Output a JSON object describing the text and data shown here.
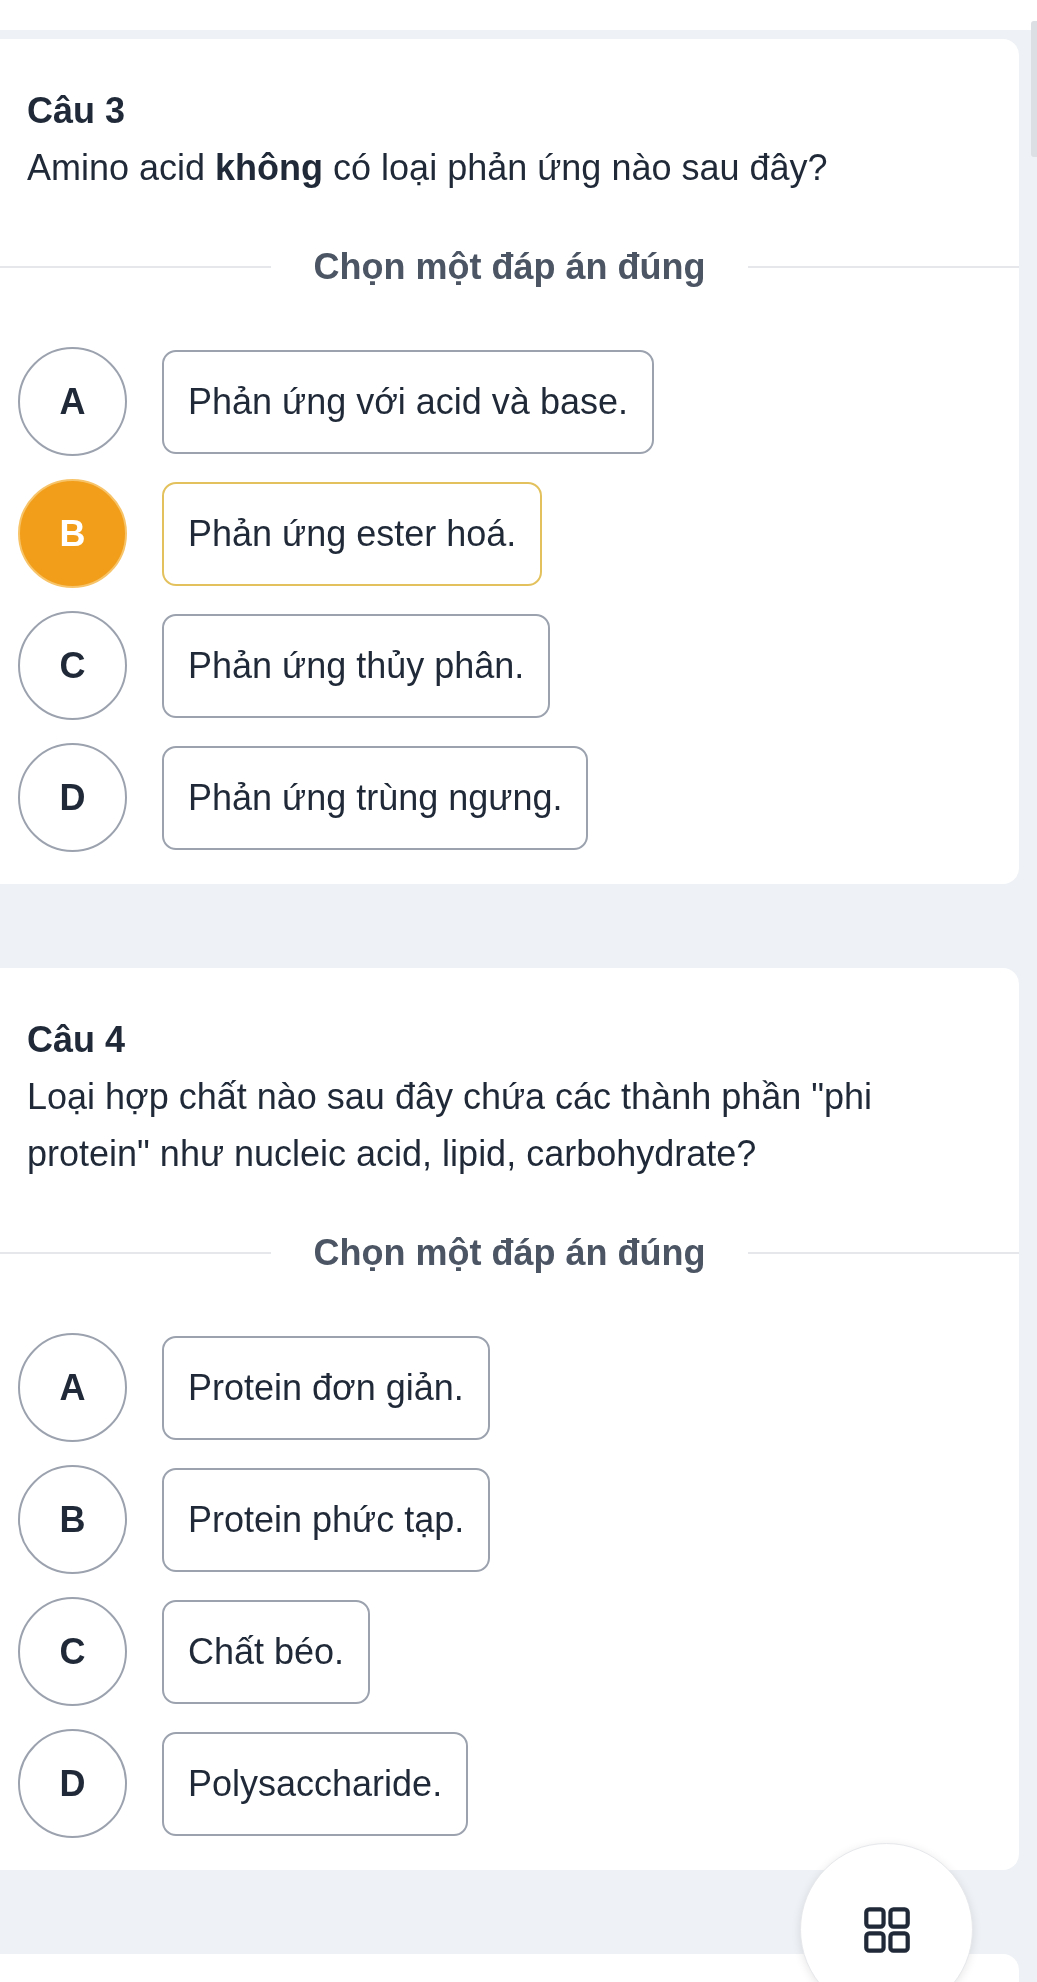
{
  "questions": [
    {
      "number": "Câu 3",
      "prompt": "Amino acid **không** có loại phản ứng nào sau đây?",
      "instruction": "Chọn một đáp án đúng",
      "options": [
        {
          "letter": "A",
          "text": "Phản ứng với acid và base.",
          "selected": false
        },
        {
          "letter": "B",
          "text": "Phản ứng ester hoá.",
          "selected": true
        },
        {
          "letter": "C",
          "text": "Phản ứng thủy phân.",
          "selected": false
        },
        {
          "letter": "D",
          "text": "Phản ứng trùng ngưng.",
          "selected": false
        }
      ]
    },
    {
      "number": "Câu 4",
      "prompt": "Loại hợp chất nào sau đây chứa các thành phần \"phi protein\" như nucleic acid, lipid, carbohydrate?",
      "instruction": "Chọn một đáp án đúng",
      "options": [
        {
          "letter": "A",
          "text": "Protein đơn giản.",
          "selected": false
        },
        {
          "letter": "B",
          "text": "Protein phức tạp.",
          "selected": false
        },
        {
          "letter": "C",
          "text": "Chất béo.",
          "selected": false
        },
        {
          "letter": "D",
          "text": "Polysaccharide.",
          "selected": false
        }
      ]
    }
  ]
}
